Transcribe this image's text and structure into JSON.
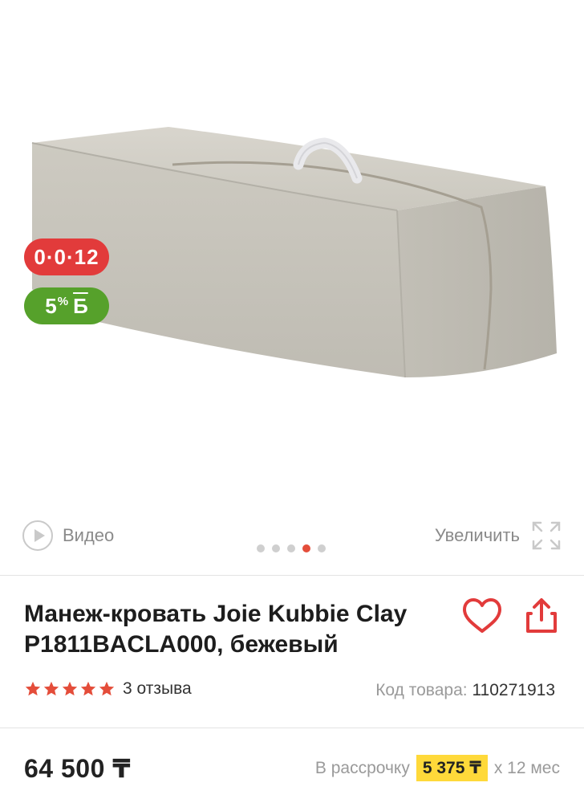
{
  "badges": {
    "installment": "0·0·12",
    "bonus_percent": "5",
    "bonus_percent_sign": "%",
    "bonus_currency": "Б"
  },
  "gallery": {
    "video_label": "Видео",
    "zoom_label": "Увеличить",
    "dots_count": 5,
    "active_dot": 4
  },
  "product": {
    "title": "Манеж-кровать Joie Kubbie Clay P1811BACLA000, бежевый",
    "rating_stars": 5,
    "reviews": "3 отзыва",
    "sku_label": "Код товара:",
    "sku_value": "110271913",
    "price": "64 500 ₸",
    "installment_prefix": "В рассрочку",
    "installment_amount": "5 375 ₸",
    "installment_suffix": "x 12 мес"
  },
  "colors": {
    "accent_red": "#e23b3b",
    "bonus_green": "#56a12b",
    "star_red": "#e44d3a",
    "installment_yellow": "#ffd93a"
  }
}
